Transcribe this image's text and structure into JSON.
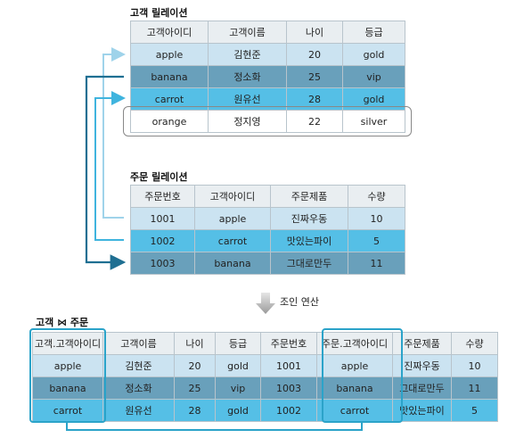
{
  "customer": {
    "title": "고객 릴레이션",
    "header": [
      "고객아이디",
      "고객이름",
      "나이",
      "등급"
    ],
    "rows": [
      [
        "apple",
        "김현준",
        "20",
        "gold"
      ],
      [
        "banana",
        "정소화",
        "25",
        "vip"
      ],
      [
        "carrot",
        "원유선",
        "28",
        "gold"
      ],
      [
        "orange",
        "정지영",
        "22",
        "silver"
      ]
    ]
  },
  "order": {
    "title": "주문 릴레이션",
    "header": [
      "주문번호",
      "고객아이디",
      "주문제품",
      "수량"
    ],
    "rows": [
      [
        "1001",
        "apple",
        "진짜우동",
        "10"
      ],
      [
        "1002",
        "carrot",
        "맛있는파이",
        "5"
      ],
      [
        "1003",
        "banana",
        "그대로만두",
        "11"
      ]
    ]
  },
  "operation": {
    "label": "조인 연산"
  },
  "result": {
    "title": "고객 ⋈ 주문",
    "header": [
      "고객.고객아이디",
      "고객이름",
      "나이",
      "등급",
      "주문번호",
      "주문.고객아이디",
      "주문제품",
      "수량"
    ],
    "rows": [
      [
        "apple",
        "김현준",
        "20",
        "gold",
        "1001",
        "apple",
        "진짜우동",
        "10"
      ],
      [
        "banana",
        "정소화",
        "25",
        "vip",
        "1003",
        "banana",
        "그대로만두",
        "11"
      ],
      [
        "carrot",
        "원유선",
        "28",
        "gold",
        "1002",
        "carrot",
        "맛있는파이",
        "5"
      ]
    ]
  },
  "colors": {
    "header": "#e9eef1",
    "light": "#cbe3f1",
    "mid": "#69a0bb",
    "bright": "#55bfe6",
    "connector": "#2ba3c9"
  }
}
